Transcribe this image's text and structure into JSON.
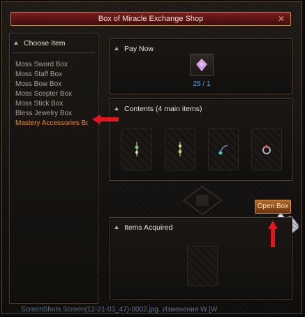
{
  "window": {
    "title": "Box of Miracle Exchange Shop",
    "close_glyph": "✕"
  },
  "choose_item": {
    "header": "Choose Item",
    "items": [
      "Moss Sword Box",
      "Moss Staff Box",
      "Moss Bow Box",
      "Moss Scepter Box",
      "Moss Stick Box",
      "Bless Jewelry Box",
      "Mastery Accessories Bo"
    ],
    "selected_index": 6
  },
  "pay_now": {
    "header": "Pay Now",
    "count": "25 / 1",
    "icon": "jewel-icon"
  },
  "contents": {
    "header": "Contents (4 main items)",
    "items": [
      "necklace-icon",
      "necklace-icon",
      "pendant-icon",
      "ring-icon"
    ]
  },
  "open_button": {
    "label": "Open Box"
  },
  "items_acquired": {
    "header": "Items Acquired"
  },
  "footer_text": "ScreenShots Screen(12-21-03_47)-0002.jpg. Изменения W [W",
  "colors": {
    "accent_orange": "#f28c1e",
    "count_blue": "#4fa6e0",
    "title_red": "#5b1513",
    "annotation_red": "#e8141c"
  }
}
